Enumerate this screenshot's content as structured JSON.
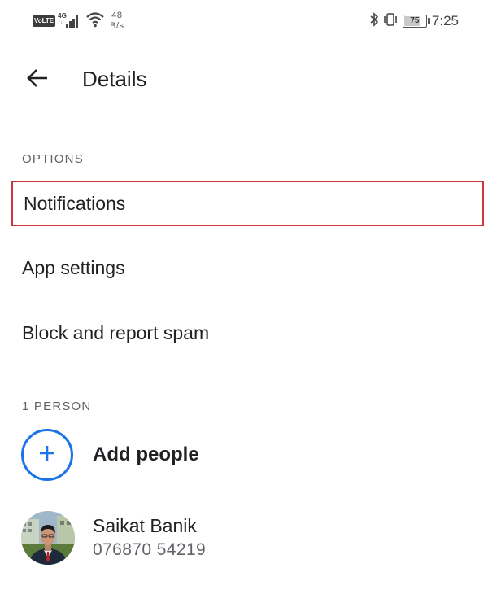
{
  "status_bar": {
    "volte": "VoLTE",
    "network": "4G",
    "network_arrows": "↑↓",
    "speed_value": "48",
    "speed_unit": "B/s",
    "battery_level": "75",
    "time": "7:25",
    "icons": [
      "volte-icon",
      "signal-icon",
      "wifi-icon",
      "bluetooth-icon",
      "vibrate-icon",
      "battery-icon"
    ]
  },
  "header": {
    "back_icon": "arrow-left-icon",
    "title": "Details"
  },
  "options": {
    "section_label": "OPTIONS",
    "items": [
      {
        "label": "Notifications",
        "highlighted": true
      },
      {
        "label": "App settings"
      },
      {
        "label": "Block and report spam"
      }
    ]
  },
  "people": {
    "section_label": "1 PERSON",
    "add_label": "Add people",
    "add_icon": "plus-icon",
    "contacts": [
      {
        "name": "Saikat Banik",
        "phone": "076870 54219",
        "avatar": "contact-photo"
      }
    ]
  },
  "colors": {
    "accent": "#1a73e8",
    "highlight_border": "#d1323f",
    "text_primary": "#202124",
    "text_secondary": "#5f6368"
  }
}
